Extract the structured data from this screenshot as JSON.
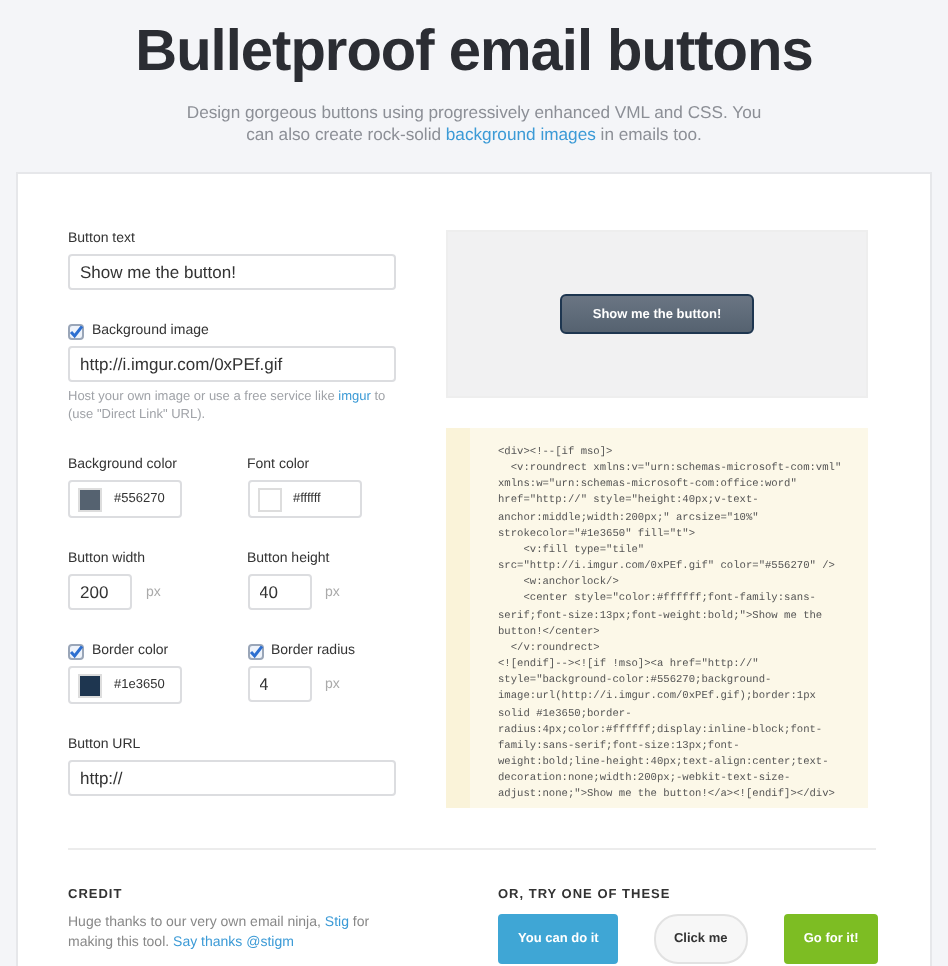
{
  "header": {
    "title": "Bulletproof email buttons",
    "subtitle": [
      {
        "kind": "text",
        "text": "Design gorgeous buttons using progressively enhanced VML and CSS. You can also create rock-solid "
      },
      {
        "kind": "link",
        "text": "background images"
      },
      {
        "kind": "text",
        "text": " in emails too."
      }
    ]
  },
  "form": {
    "fields": [
      {
        "kind": "text",
        "label": "Button text",
        "value": "Show me the button!"
      },
      {
        "kind": "text",
        "label": "Background image",
        "checked": true,
        "value": "http://i.imgur.com/0xPEf.gif",
        "hint": [
          {
            "kind": "text",
            "text": "Host your own image or use a free service like "
          },
          {
            "kind": "link",
            "text": "imgur"
          },
          {
            "kind": "text",
            "text": " to (use \"Direct Link\" URL)."
          }
        ]
      },
      {
        "kind": "pair",
        "items": [
          {
            "kind": "color",
            "label": "Background color",
            "color": "#556270",
            "value": "#556270"
          },
          {
            "kind": "color",
            "label": "Font color",
            "color": "#ffffff",
            "value": "#ffffff"
          }
        ]
      },
      {
        "kind": "pair",
        "items": [
          {
            "kind": "number",
            "label": "Button width",
            "value": "200",
            "unit": "px"
          },
          {
            "kind": "number",
            "label": "Button height",
            "value": "40",
            "unit": "px"
          }
        ]
      },
      {
        "kind": "pair",
        "items": [
          {
            "kind": "color",
            "label": "Border color",
            "checked": true,
            "color": "#1e3650",
            "value": "#1e3650"
          },
          {
            "kind": "number",
            "label": "Border radius",
            "checked": true,
            "value": "4",
            "unit": "px"
          }
        ]
      },
      {
        "kind": "text",
        "label": "Button URL",
        "value": "http://"
      }
    ]
  },
  "preview": {
    "button_label": "Show me the button!"
  },
  "code_lines": [
    "<div><!--[if mso]>",
    "  <v:roundrect xmlns:v=\"urn:schemas-microsoft-com:vml\"",
    "xmlns:w=\"urn:schemas-microsoft-com:office:word\"",
    "href=\"http://\" style=\"height:40px;v-text-",
    "anchor:middle;width:200px;\" arcsize=\"10%\"",
    "strokecolor=\"#1e3650\" fill=\"t\">",
    "    <v:fill type=\"tile\"",
    "src=\"http://i.imgur.com/0xPEf.gif\" color=\"#556270\" />",
    "    <w:anchorlock/>",
    "    <center style=\"color:#ffffff;font-family:sans-",
    "serif;font-size:13px;font-weight:bold;\">Show me the",
    "button!</center>",
    "  </v:roundrect>",
    "<![endif]--><![if !mso]><a href=\"http://\"",
    "style=\"background-color:#556270;background-",
    "image:url(http://i.imgur.com/0xPEf.gif);border:1px",
    "solid #1e3650;border-",
    "radius:4px;color:#ffffff;display:inline-block;font-",
    "family:sans-serif;font-size:13px;font-",
    "weight:bold;line-height:40px;text-align:center;text-",
    "decoration:none;width:200px;-webkit-text-size-",
    "adjust:none;\">Show me the button!</a><![endif]></div>"
  ],
  "credit": {
    "heading": "CREDIT",
    "text": [
      {
        "kind": "text",
        "text": "Huge thanks to our very own email ninja, "
      },
      {
        "kind": "link",
        "text": "Stig"
      },
      {
        "kind": "text",
        "text": " for making this tool. "
      },
      {
        "kind": "link",
        "text": "Say thanks @stigm"
      }
    ]
  },
  "alternatives": {
    "heading": "OR, TRY ONE OF THESE",
    "buttons": [
      {
        "label": "You can do it",
        "color": "#3fa6d5"
      },
      {
        "label": "Click me",
        "color": "#f7f7f7"
      },
      {
        "label": "Go for it!",
        "color": "#7dbd23"
      }
    ]
  }
}
